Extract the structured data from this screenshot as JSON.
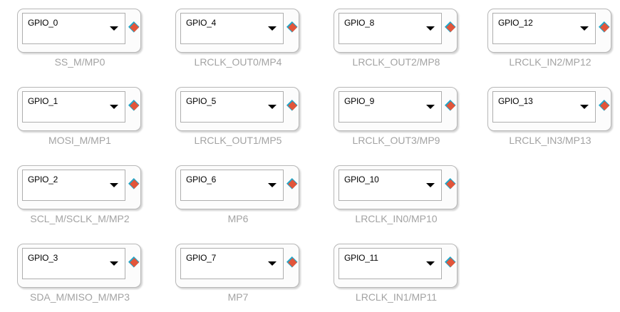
{
  "blocks": [
    {
      "value": "GPIO_0",
      "label": "SS_M/MP0"
    },
    {
      "value": "GPIO_1",
      "label": "MOSI_M/MP1"
    },
    {
      "value": "GPIO_2",
      "label": "SCL_M/SCLK_M/MP2"
    },
    {
      "value": "GPIO_3",
      "label": "SDA_M/MISO_M/MP3"
    },
    {
      "value": "GPIO_4",
      "label": "LRCLK_OUT0/MP4"
    },
    {
      "value": "GPIO_5",
      "label": "LRCLK_OUT1/MP5"
    },
    {
      "value": "GPIO_6",
      "label": "MP6"
    },
    {
      "value": "GPIO_7",
      "label": "MP7"
    },
    {
      "value": "GPIO_8",
      "label": "LRCLK_OUT2/MP8"
    },
    {
      "value": "GPIO_9",
      "label": "LRCLK_OUT3/MP9"
    },
    {
      "value": "GPIO_10",
      "label": "LRCLK_IN0/MP10"
    },
    {
      "value": "GPIO_11",
      "label": "LRCLK_IN1/MP11"
    },
    {
      "value": "GPIO_12",
      "label": "LRCLK_IN2/MP12"
    },
    {
      "value": "GPIO_13",
      "label": "LRCLK_IN3/MP13"
    }
  ],
  "colors": {
    "label_text": "#a3a3a3",
    "pin_fill": "#e2553a",
    "pin_edge": "#1fa6c9"
  }
}
